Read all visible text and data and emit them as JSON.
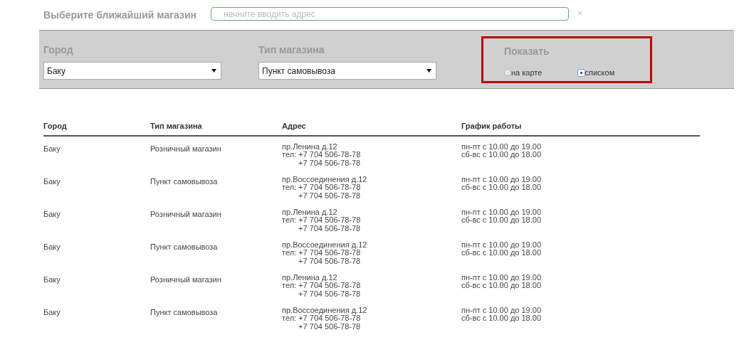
{
  "header": {
    "title": "Выберите ближайший магазин",
    "search": {
      "placeholder": "начните вводить адрес"
    },
    "clear": "×"
  },
  "filters": {
    "city": {
      "label": "Город",
      "value": "Баку"
    },
    "store_type": {
      "label": "Тип магазина",
      "value": "Пункт самовывоза"
    },
    "show": {
      "label": "Показать",
      "highlighted": true,
      "options": [
        {
          "label": "на карте",
          "selected": false
        },
        {
          "label": "списком",
          "selected": true
        }
      ]
    }
  },
  "table": {
    "columns": [
      "Город",
      "Тип магазина",
      "Адрес",
      "График работы"
    ],
    "rows": [
      {
        "city": "Баку",
        "type": "Розничный магазин",
        "address": [
          "пр.Ленина д.12",
          "тел: +7 704 506-78-78",
          "+7 704 506-78-78"
        ],
        "schedule": [
          "пн-пт с 10.00 до 19.00",
          "сб-вс с 10.00 до 18.00"
        ]
      },
      {
        "city": "Баку",
        "type": "Пункт самовывоза",
        "address": [
          "пр.Воссоединения д.12",
          "тел: +7 704 506-78-78",
          "+7 704 506-78-78"
        ],
        "schedule": [
          "пн-пт с 10.00 до 19.00",
          "сб-вс с 10.00 до 18.00"
        ]
      },
      {
        "city": "Баку",
        "type": "Розничный магазин",
        "address": [
          "пр.Ленина д.12",
          "тел: +7 704 506-78-78",
          "+7 704 506-78-78"
        ],
        "schedule": [
          "пн-пт с 10.00 до 19.00",
          "сб-вс с 10.00 до 18.00"
        ]
      },
      {
        "city": "Баку",
        "type": "Пункт самовывоза",
        "address": [
          "пр.Воссоединения д.12",
          "тел: +7 704 506-78-78",
          "+7 704 506-78-78"
        ],
        "schedule": [
          "пн-пт с 10.00 до 19.00",
          "сб-вс с 10.00 до 18.00"
        ]
      },
      {
        "city": "Баку",
        "type": "Розничный магазин",
        "address": [
          "пр.Ленина д.12",
          "тел: +7 704 506-78-78",
          "+7 704 506-78-78"
        ],
        "schedule": [
          "пн-пт с 10.00 до 19.00",
          "сб-вс с 10.00 до 18.00"
        ]
      },
      {
        "city": "Баку",
        "type": "Пункт самовывоза",
        "address": [
          "пр.Воссоединения д.12",
          "тел: +7 704 506-78-78",
          "+7 704 506-78-78"
        ],
        "schedule": [
          "пн-пт с 10.00 до 19.00",
          "сб-вс с 10.00 до 18.00"
        ]
      }
    ]
  }
}
